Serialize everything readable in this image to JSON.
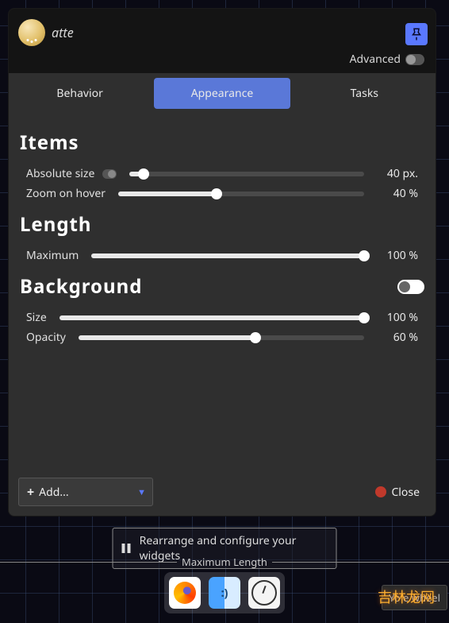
{
  "app_name": "atte",
  "advanced_label": "Advanced",
  "tabs": {
    "behavior": "Behavior",
    "appearance": "Appearance",
    "tasks": "Tasks"
  },
  "sections": {
    "items": {
      "title": "Items",
      "absolute_size": {
        "label": "Absolute size",
        "value": "40 px.",
        "percent": 6
      },
      "zoom_on_hover": {
        "label": "Zoom on hover",
        "value": "40 %",
        "percent": 40
      }
    },
    "length": {
      "title": "Length",
      "maximum": {
        "label": "Maximum",
        "value": "100 %",
        "percent": 100
      }
    },
    "background": {
      "title": "Background",
      "size": {
        "label": "Size",
        "value": "100 %",
        "percent": 100
      },
      "opacity": {
        "label": "Opacity",
        "value": "60 %",
        "percent": 62
      }
    }
  },
  "footer": {
    "add": "Add...",
    "close": "Close"
  },
  "widget_bar": "Rearrange and configure your widgets",
  "max_length_label": "Maximum Length",
  "tooltip_fragment": "Yo                            e wheel",
  "watermark": "吉林龙网"
}
